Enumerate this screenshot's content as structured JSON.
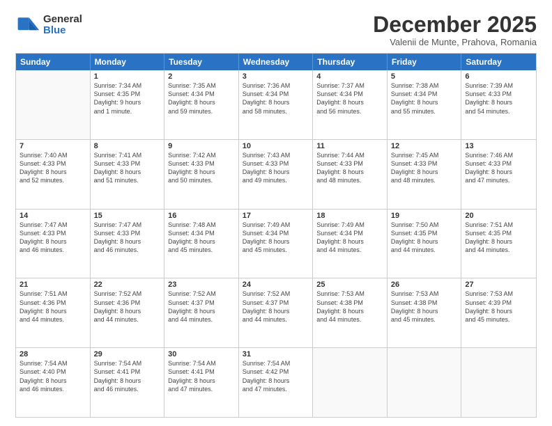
{
  "logo": {
    "general": "General",
    "blue": "Blue"
  },
  "header": {
    "month": "December 2025",
    "location": "Valenii de Munte, Prahova, Romania"
  },
  "weekdays": [
    "Sunday",
    "Monday",
    "Tuesday",
    "Wednesday",
    "Thursday",
    "Friday",
    "Saturday"
  ],
  "rows": [
    [
      {
        "day": "",
        "empty": true,
        "lines": []
      },
      {
        "day": "1",
        "empty": false,
        "lines": [
          "Sunrise: 7:34 AM",
          "Sunset: 4:35 PM",
          "Daylight: 9 hours",
          "and 1 minute."
        ]
      },
      {
        "day": "2",
        "empty": false,
        "lines": [
          "Sunrise: 7:35 AM",
          "Sunset: 4:34 PM",
          "Daylight: 8 hours",
          "and 59 minutes."
        ]
      },
      {
        "day": "3",
        "empty": false,
        "lines": [
          "Sunrise: 7:36 AM",
          "Sunset: 4:34 PM",
          "Daylight: 8 hours",
          "and 58 minutes."
        ]
      },
      {
        "day": "4",
        "empty": false,
        "lines": [
          "Sunrise: 7:37 AM",
          "Sunset: 4:34 PM",
          "Daylight: 8 hours",
          "and 56 minutes."
        ]
      },
      {
        "day": "5",
        "empty": false,
        "lines": [
          "Sunrise: 7:38 AM",
          "Sunset: 4:34 PM",
          "Daylight: 8 hours",
          "and 55 minutes."
        ]
      },
      {
        "day": "6",
        "empty": false,
        "lines": [
          "Sunrise: 7:39 AM",
          "Sunset: 4:33 PM",
          "Daylight: 8 hours",
          "and 54 minutes."
        ]
      }
    ],
    [
      {
        "day": "7",
        "empty": false,
        "lines": [
          "Sunrise: 7:40 AM",
          "Sunset: 4:33 PM",
          "Daylight: 8 hours",
          "and 52 minutes."
        ]
      },
      {
        "day": "8",
        "empty": false,
        "lines": [
          "Sunrise: 7:41 AM",
          "Sunset: 4:33 PM",
          "Daylight: 8 hours",
          "and 51 minutes."
        ]
      },
      {
        "day": "9",
        "empty": false,
        "lines": [
          "Sunrise: 7:42 AM",
          "Sunset: 4:33 PM",
          "Daylight: 8 hours",
          "and 50 minutes."
        ]
      },
      {
        "day": "10",
        "empty": false,
        "lines": [
          "Sunrise: 7:43 AM",
          "Sunset: 4:33 PM",
          "Daylight: 8 hours",
          "and 49 minutes."
        ]
      },
      {
        "day": "11",
        "empty": false,
        "lines": [
          "Sunrise: 7:44 AM",
          "Sunset: 4:33 PM",
          "Daylight: 8 hours",
          "and 48 minutes."
        ]
      },
      {
        "day": "12",
        "empty": false,
        "lines": [
          "Sunrise: 7:45 AM",
          "Sunset: 4:33 PM",
          "Daylight: 8 hours",
          "and 48 minutes."
        ]
      },
      {
        "day": "13",
        "empty": false,
        "lines": [
          "Sunrise: 7:46 AM",
          "Sunset: 4:33 PM",
          "Daylight: 8 hours",
          "and 47 minutes."
        ]
      }
    ],
    [
      {
        "day": "14",
        "empty": false,
        "lines": [
          "Sunrise: 7:47 AM",
          "Sunset: 4:33 PM",
          "Daylight: 8 hours",
          "and 46 minutes."
        ]
      },
      {
        "day": "15",
        "empty": false,
        "lines": [
          "Sunrise: 7:47 AM",
          "Sunset: 4:33 PM",
          "Daylight: 8 hours",
          "and 46 minutes."
        ]
      },
      {
        "day": "16",
        "empty": false,
        "lines": [
          "Sunrise: 7:48 AM",
          "Sunset: 4:34 PM",
          "Daylight: 8 hours",
          "and 45 minutes."
        ]
      },
      {
        "day": "17",
        "empty": false,
        "lines": [
          "Sunrise: 7:49 AM",
          "Sunset: 4:34 PM",
          "Daylight: 8 hours",
          "and 45 minutes."
        ]
      },
      {
        "day": "18",
        "empty": false,
        "lines": [
          "Sunrise: 7:49 AM",
          "Sunset: 4:34 PM",
          "Daylight: 8 hours",
          "and 44 minutes."
        ]
      },
      {
        "day": "19",
        "empty": false,
        "lines": [
          "Sunrise: 7:50 AM",
          "Sunset: 4:35 PM",
          "Daylight: 8 hours",
          "and 44 minutes."
        ]
      },
      {
        "day": "20",
        "empty": false,
        "lines": [
          "Sunrise: 7:51 AM",
          "Sunset: 4:35 PM",
          "Daylight: 8 hours",
          "and 44 minutes."
        ]
      }
    ],
    [
      {
        "day": "21",
        "empty": false,
        "lines": [
          "Sunrise: 7:51 AM",
          "Sunset: 4:36 PM",
          "Daylight: 8 hours",
          "and 44 minutes."
        ]
      },
      {
        "day": "22",
        "empty": false,
        "lines": [
          "Sunrise: 7:52 AM",
          "Sunset: 4:36 PM",
          "Daylight: 8 hours",
          "and 44 minutes."
        ]
      },
      {
        "day": "23",
        "empty": false,
        "lines": [
          "Sunrise: 7:52 AM",
          "Sunset: 4:37 PM",
          "Daylight: 8 hours",
          "and 44 minutes."
        ]
      },
      {
        "day": "24",
        "empty": false,
        "lines": [
          "Sunrise: 7:52 AM",
          "Sunset: 4:37 PM",
          "Daylight: 8 hours",
          "and 44 minutes."
        ]
      },
      {
        "day": "25",
        "empty": false,
        "lines": [
          "Sunrise: 7:53 AM",
          "Sunset: 4:38 PM",
          "Daylight: 8 hours",
          "and 44 minutes."
        ]
      },
      {
        "day": "26",
        "empty": false,
        "lines": [
          "Sunrise: 7:53 AM",
          "Sunset: 4:38 PM",
          "Daylight: 8 hours",
          "and 45 minutes."
        ]
      },
      {
        "day": "27",
        "empty": false,
        "lines": [
          "Sunrise: 7:53 AM",
          "Sunset: 4:39 PM",
          "Daylight: 8 hours",
          "and 45 minutes."
        ]
      }
    ],
    [
      {
        "day": "28",
        "empty": false,
        "lines": [
          "Sunrise: 7:54 AM",
          "Sunset: 4:40 PM",
          "Daylight: 8 hours",
          "and 46 minutes."
        ]
      },
      {
        "day": "29",
        "empty": false,
        "lines": [
          "Sunrise: 7:54 AM",
          "Sunset: 4:41 PM",
          "Daylight: 8 hours",
          "and 46 minutes."
        ]
      },
      {
        "day": "30",
        "empty": false,
        "lines": [
          "Sunrise: 7:54 AM",
          "Sunset: 4:41 PM",
          "Daylight: 8 hours",
          "and 47 minutes."
        ]
      },
      {
        "day": "31",
        "empty": false,
        "lines": [
          "Sunrise: 7:54 AM",
          "Sunset: 4:42 PM",
          "Daylight: 8 hours",
          "and 47 minutes."
        ]
      },
      {
        "day": "",
        "empty": true,
        "lines": []
      },
      {
        "day": "",
        "empty": true,
        "lines": []
      },
      {
        "day": "",
        "empty": true,
        "lines": []
      }
    ]
  ]
}
